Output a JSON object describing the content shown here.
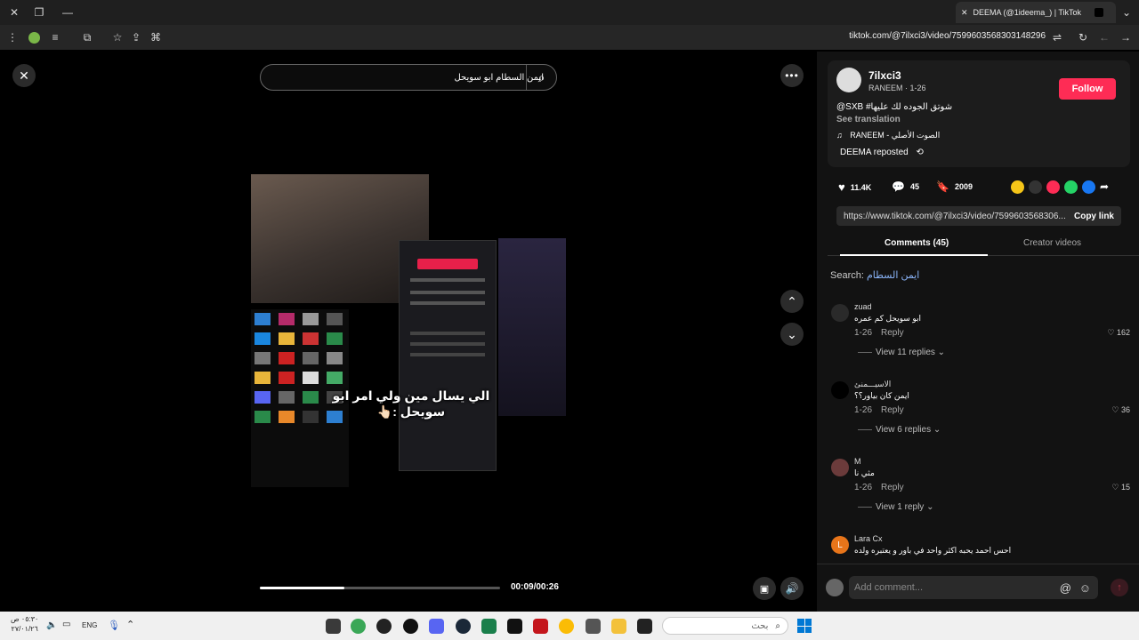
{
  "browser": {
    "tab_title": "DEEMA (@1ideema_) | TikTok",
    "url": "tiktok.com/@7ilxci3/video/7599603568303148296"
  },
  "player": {
    "search_text": "ايمن السطام ابو سويحل",
    "caption_line1": "الي يسال مين ولي امر ابو",
    "caption_line2": "سويحل :👆🏻",
    "time": "00:09/00:26",
    "progress_fraction": 0.35
  },
  "author": {
    "username": "7ilxci3",
    "display": "RANEEM · 1-26",
    "follow_label": "Follow",
    "description": "@SXB #شوتق الجوده لك عليها",
    "see_translation": "See translation",
    "music": "RANEEM - الصوت الأصلي",
    "reposted": "DEEMA reposted"
  },
  "stats": {
    "likes": "11.4K",
    "comments": "45",
    "saves": "2009"
  },
  "share": {
    "link": "https://www.tiktok.com/@7ilxci3/video/7599603568306...",
    "copy_label": "Copy link"
  },
  "tabs": {
    "comments": "Comments (45)",
    "creator_videos": "Creator videos"
  },
  "search_label": "Search:",
  "search_term": "ايمن السطام",
  "comments": [
    {
      "name": "zuad",
      "text": "ابو سويحل كم عمره",
      "date": "1-26",
      "reply": "Reply",
      "likes": "162",
      "replies": "View 11 replies"
    },
    {
      "name": "الاسيـــمنئ",
      "text": "ايمن كان بياور؟؟",
      "date": "1-26",
      "reply": "Reply",
      "likes": "36",
      "replies": "View 6 replies"
    },
    {
      "name": "M",
      "text": "مثي نا",
      "date": "1-26",
      "reply": "Reply",
      "likes": "15",
      "replies": "View 1 reply"
    },
    {
      "name": "Lara Cx",
      "text": "احس احمد يحبه اكثر واحد في باور و يعتبره ولده",
      "date": "",
      "reply": "",
      "likes": "",
      "replies": ""
    }
  ],
  "add_comment_placeholder": "Add comment...",
  "taskbar": {
    "search_placeholder": "بحث",
    "lang": "ENG",
    "time": "٠٥:٣٠ ص",
    "date": "٢٧/٠١/٢٦"
  }
}
